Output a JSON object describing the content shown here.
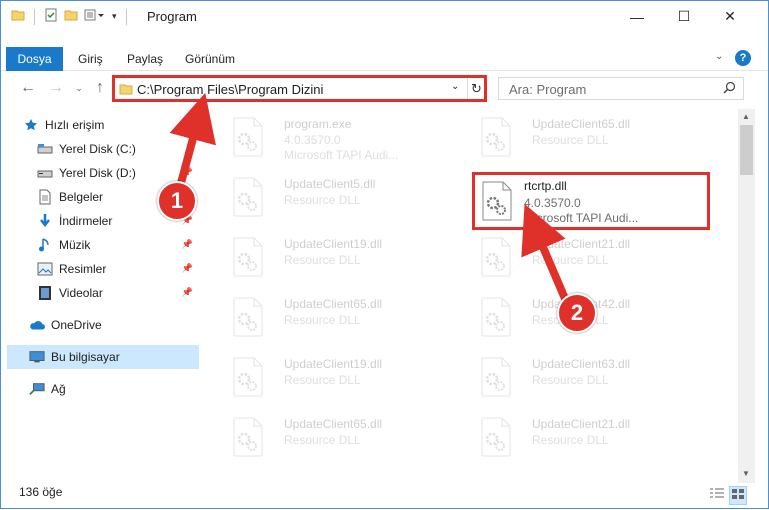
{
  "window": {
    "title": "Program",
    "controls": {
      "minimize": "—",
      "maximize": "☐",
      "close": "✕"
    }
  },
  "ribbon": {
    "file_tab": "Dosya",
    "tabs": [
      "Giriş",
      "Paylaş",
      "Görünüm"
    ],
    "help": "?"
  },
  "nav": {
    "address_path": "C:\\Program Files\\Program Dizini",
    "search_placeholder": "Ara: Program"
  },
  "sidebar": {
    "items": [
      {
        "label": "Hızlı erişim",
        "icon": "star-icon"
      },
      {
        "label": "Yerel Disk (C:)",
        "icon": "drive-icon"
      },
      {
        "label": "Yerel Disk (D:)",
        "icon": "drive-icon"
      },
      {
        "label": "Belgeler",
        "icon": "documents-icon"
      },
      {
        "label": "İndirmeler",
        "icon": "download-icon"
      },
      {
        "label": "Müzik",
        "icon": "music-icon"
      },
      {
        "label": "Resimler",
        "icon": "pictures-icon"
      },
      {
        "label": "Videolar",
        "icon": "video-icon"
      },
      {
        "label": "OneDrive",
        "icon": "cloud-icon"
      },
      {
        "label": "Bu bilgisayar",
        "icon": "computer-icon"
      },
      {
        "label": "Ağ",
        "icon": "network-icon"
      }
    ]
  },
  "files": {
    "col1": [
      {
        "name": "program.exe",
        "sub1": "4.0.3570.0",
        "sub2": "Microsoft TAPI Audi..."
      },
      {
        "name": "UpdateClient5.dll",
        "sub1": "Resource DLL",
        "sub2": ""
      },
      {
        "name": "UpdateClient19.dll",
        "sub1": "Resource DLL",
        "sub2": ""
      },
      {
        "name": "UpdateClient65.dll",
        "sub1": "Resource DLL",
        "sub2": ""
      },
      {
        "name": "UpdateClient19.dll",
        "sub1": "Resource DLL",
        "sub2": ""
      },
      {
        "name": "UpdateClient65.dll",
        "sub1": "Resource DLL",
        "sub2": ""
      }
    ],
    "col2": [
      {
        "name": "UpdateClient65.dll",
        "sub1": "Resource DLL",
        "sub2": ""
      },
      {
        "name": "rtcrtp.dll",
        "sub1": "4.0.3570.0",
        "sub2": "Microsoft TAPI Audi..."
      },
      {
        "name": "UpdateClient21.dll",
        "sub1": "Resource DLL",
        "sub2": ""
      },
      {
        "name": "UpdateClient42.dll",
        "sub1": "Resource DLL",
        "sub2": ""
      },
      {
        "name": "UpdateClient63.dll",
        "sub1": "Resource DLL",
        "sub2": ""
      },
      {
        "name": "UpdateClient21.dll",
        "sub1": "Resource DLL",
        "sub2": ""
      }
    ]
  },
  "status": {
    "item_count": "136 öğe"
  },
  "annotations": {
    "step1": "1",
    "step2": "2"
  },
  "colors": {
    "accent": "#1979ca",
    "highlight": "#e0302a",
    "selected": "#cce8ff"
  }
}
